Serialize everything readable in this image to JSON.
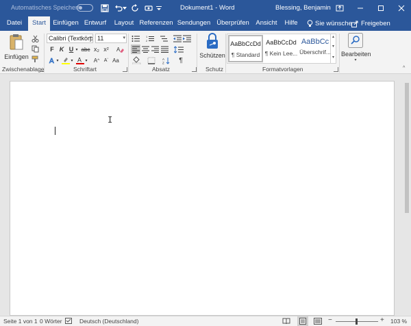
{
  "titlebar": {
    "autosave_label": "Automatisches Speichern",
    "document_title": "Dokument1 - Word",
    "user_name": "Blessing, Benjamin",
    "icons": [
      "save-icon",
      "undo-icon",
      "redo-icon",
      "customize-qat-icon",
      "ribbon-display-icon",
      "minimize-icon",
      "maximize-icon",
      "close-icon"
    ]
  },
  "tabs": [
    "Datei",
    "Start",
    "Einfügen",
    "Entwurf",
    "Layout",
    "Referenzen",
    "Sendungen",
    "Überprüfen",
    "Ansicht",
    "Hilfe"
  ],
  "active_tab": "Start",
  "tell_me": "Sie wünsche",
  "share_label": "Freigeben",
  "ribbon": {
    "clipboard": {
      "label": "Zwischenablage",
      "paste_label": "Einfügen"
    },
    "font": {
      "label": "Schriftart",
      "font_name": "Calibri (Textkörpe",
      "font_size": "11",
      "bold": "F",
      "italic": "K",
      "underline": "U",
      "strike": "abc",
      "subscript": "x₂",
      "superscript": "x²"
    },
    "paragraph": {
      "label": "Absatz"
    },
    "protect": {
      "label": "Schutz",
      "button_label": "Schützen"
    },
    "styles": {
      "label": "Formatvorlagen",
      "items": [
        {
          "preview": "AaBbCcDd",
          "name": "¶ Standard"
        },
        {
          "preview": "AaBbCcDd",
          "name": "¶ Kein Lee..."
        },
        {
          "preview": "AaBbCc",
          "name": "Überschrif..."
        }
      ]
    },
    "editing": {
      "label": "Bearbeiten"
    }
  },
  "statusbar": {
    "page": "Seite 1 von 1",
    "words": "0 Wörter",
    "language": "Deutsch (Deutschland)",
    "zoom": "103 %"
  },
  "colors": {
    "word_blue": "#2b579a",
    "ribbon_bg": "#f3f3f3",
    "canvas_bg": "#e6e6e6"
  }
}
